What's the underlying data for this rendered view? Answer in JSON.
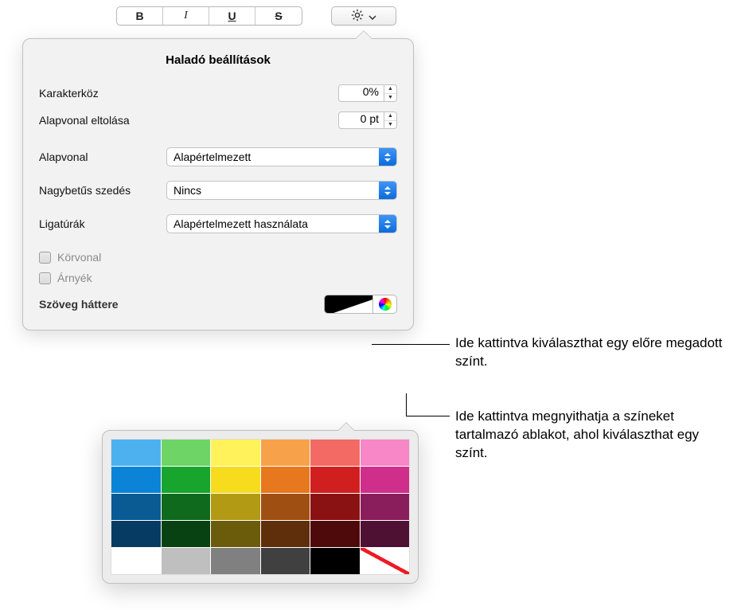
{
  "toolbar": {
    "bold": "B",
    "italic": "I",
    "underline": "U",
    "strike": "S"
  },
  "popover": {
    "title": "Haladó beállítások",
    "char_spacing_label": "Karakterköz",
    "char_spacing_value": "0%",
    "baseline_shift_label": "Alapvonal eltolása",
    "baseline_shift_value": "0 pt",
    "baseline_label": "Alapvonal",
    "baseline_value": "Alapértelmezett",
    "caps_label": "Nagybetűs szedés",
    "caps_value": "Nincs",
    "ligatures_label": "Ligatúrák",
    "ligatures_value": "Alapértelmezett használata",
    "outline_label": "Körvonal",
    "shadow_label": "Árnyék",
    "text_bg_label": "Szöveg háttere"
  },
  "palette": {
    "rows": [
      [
        "#4db1f0",
        "#6fd466",
        "#fff25a",
        "#f7a24a",
        "#f26a63",
        "#f787c6"
      ],
      [
        "#0b84d8",
        "#17a52e",
        "#f7dc1e",
        "#e8781e",
        "#d11f1f",
        "#cf2f8a"
      ],
      [
        "#0a5a94",
        "#0f6a1e",
        "#b39a14",
        "#a04f12",
        "#8a1212",
        "#8a1e5c"
      ],
      [
        "#063b63",
        "#084213",
        "#6b5c0c",
        "#5f2e0a",
        "#4e0a0a",
        "#4e1134"
      ],
      [
        "#ffffff",
        "#bfbfbf",
        "#808080",
        "#404040",
        "#000000",
        "#ffffff"
      ]
    ]
  },
  "callouts": {
    "preset": "Ide kattintva kiválaszthat egy előre megadott színt.",
    "colorwindow": "Ide kattintva megnyithatja a színeket tartalmazó ablakot, ahol kiválaszthat egy színt."
  }
}
